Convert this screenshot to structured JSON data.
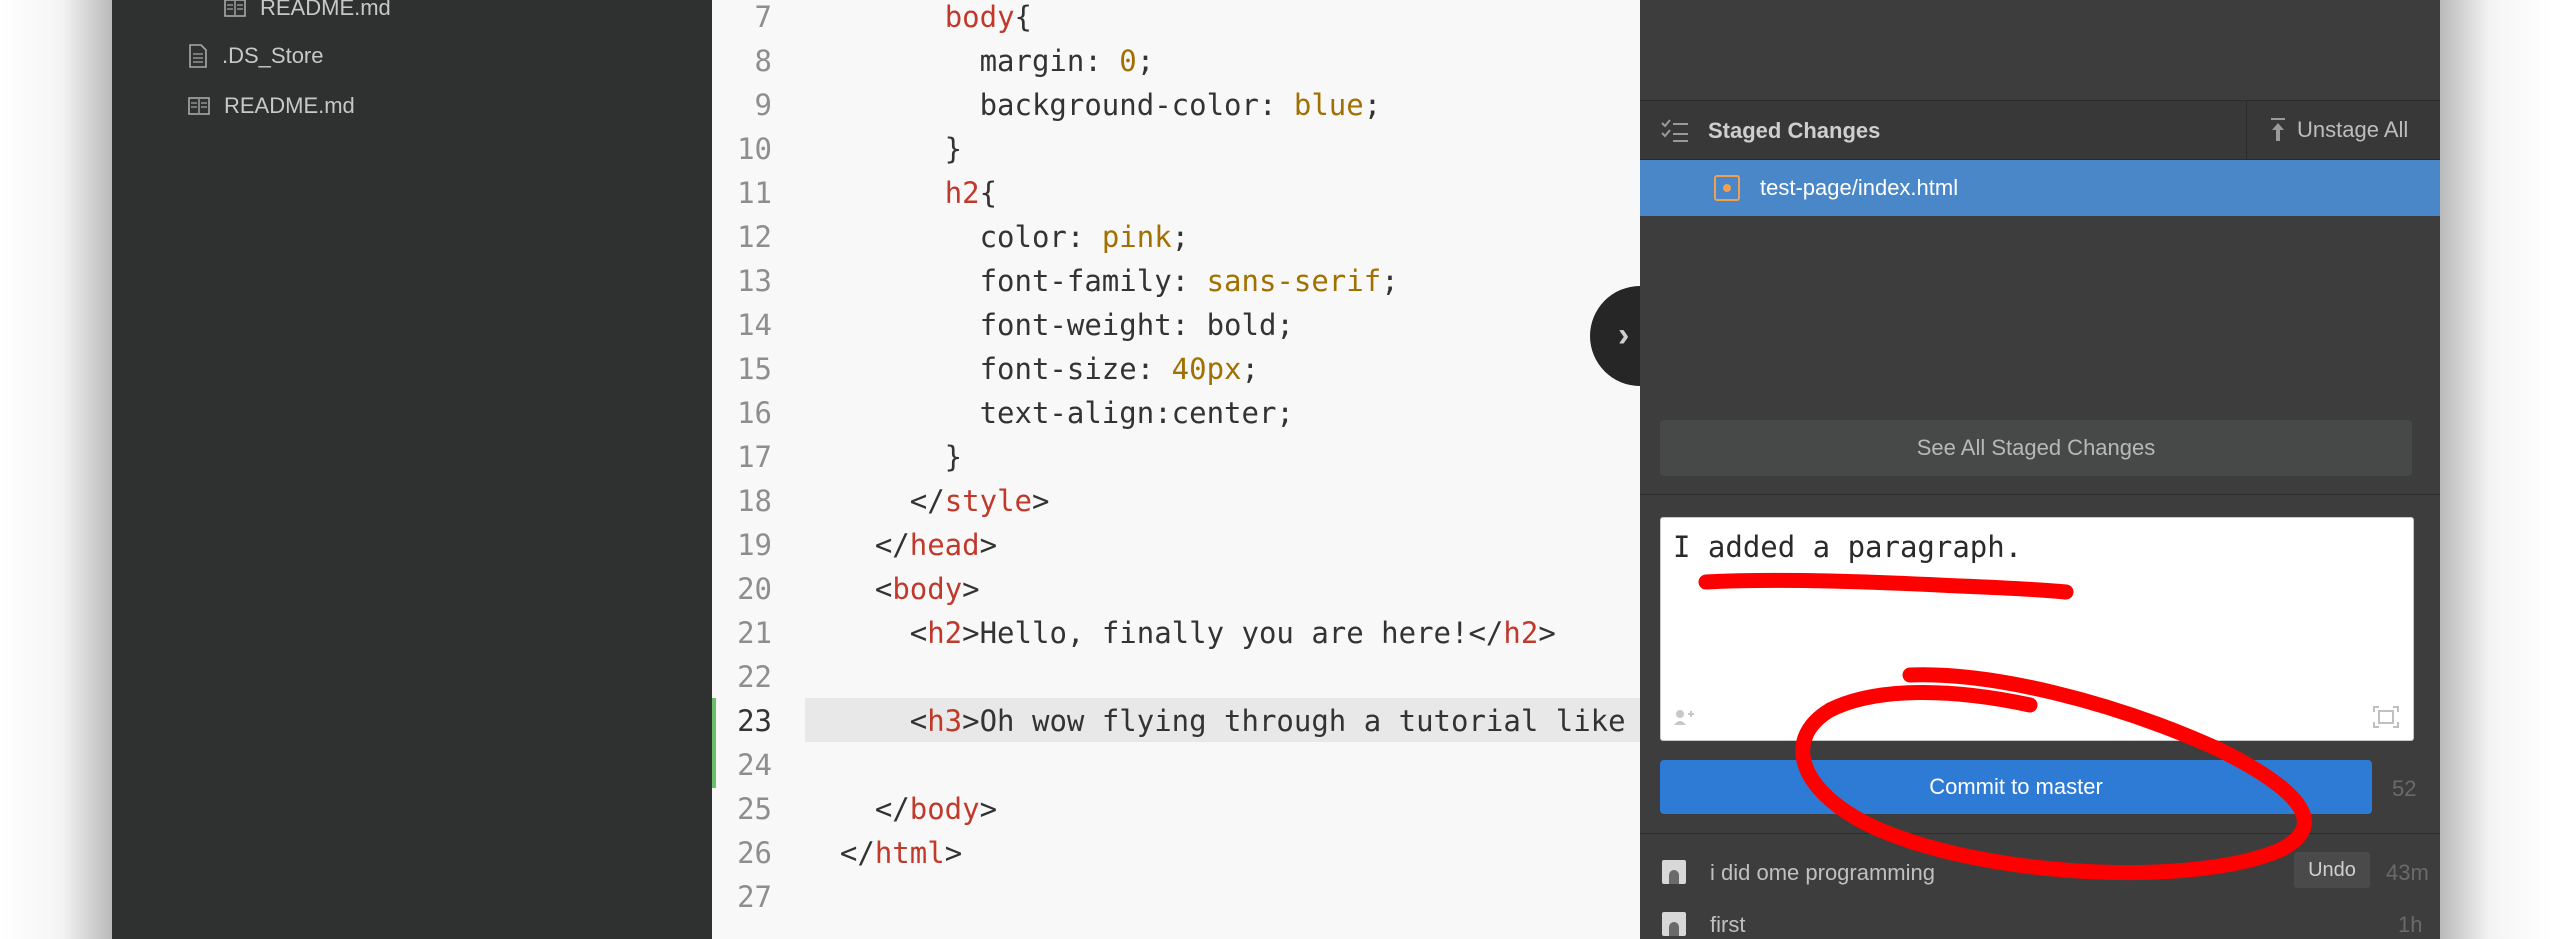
{
  "sidebar": {
    "files": [
      {
        "name": "README.md",
        "icon": "markdown-file-icon"
      },
      {
        "name": ".DS_Store",
        "icon": "text-file-icon"
      },
      {
        "name": "README.md",
        "icon": "markdown-file-icon"
      }
    ]
  },
  "editor": {
    "lines": [
      {
        "n": "7",
        "code": [
          [
            "        ",
            ""
          ],
          [
            "body",
            "tag"
          ],
          [
            "{",
            ""
          ]
        ]
      },
      {
        "n": "8",
        "code": [
          [
            "          margin: ",
            ""
          ],
          [
            "0",
            "val"
          ],
          [
            ";",
            ""
          ]
        ]
      },
      {
        "n": "9",
        "code": [
          [
            "          background-color: ",
            ""
          ],
          [
            "blue",
            "val"
          ],
          [
            ";",
            ""
          ]
        ]
      },
      {
        "n": "10",
        "code": [
          [
            "        }",
            ""
          ]
        ]
      },
      {
        "n": "11",
        "code": [
          [
            "        ",
            ""
          ],
          [
            "h2",
            "tag"
          ],
          [
            "{",
            ""
          ]
        ]
      },
      {
        "n": "12",
        "code": [
          [
            "          color: ",
            ""
          ],
          [
            "pink",
            "val"
          ],
          [
            ";",
            ""
          ]
        ]
      },
      {
        "n": "13",
        "code": [
          [
            "          font-family: ",
            ""
          ],
          [
            "sans-serif",
            "val"
          ],
          [
            ";",
            ""
          ]
        ]
      },
      {
        "n": "14",
        "code": [
          [
            "          font-weight: bold;",
            ""
          ]
        ]
      },
      {
        "n": "15",
        "code": [
          [
            "          font-size: ",
            ""
          ],
          [
            "40px",
            "val"
          ],
          [
            ";",
            ""
          ]
        ]
      },
      {
        "n": "16",
        "code": [
          [
            "          text-align:center;",
            ""
          ]
        ]
      },
      {
        "n": "17",
        "code": [
          [
            "        }",
            ""
          ]
        ]
      },
      {
        "n": "18",
        "code": [
          [
            "      </",
            ""
          ],
          [
            "style",
            "tag"
          ],
          [
            ">",
            ""
          ]
        ]
      },
      {
        "n": "19",
        "code": [
          [
            "    </",
            ""
          ],
          [
            "head",
            "tag"
          ],
          [
            ">",
            ""
          ]
        ]
      },
      {
        "n": "20",
        "code": [
          [
            "    <",
            ""
          ],
          [
            "body",
            "tag"
          ],
          [
            ">",
            ""
          ]
        ]
      },
      {
        "n": "21",
        "code": [
          [
            "      <",
            ""
          ],
          [
            "h2",
            "tag"
          ],
          [
            ">Hello, finally you are here!</",
            ""
          ],
          [
            "h2",
            "tag"
          ],
          [
            ">",
            ""
          ]
        ]
      },
      {
        "n": "22",
        "code": []
      },
      {
        "n": "23",
        "code": [
          [
            "      <",
            ""
          ],
          [
            "h3",
            "tag"
          ],
          [
            ">Oh wow flying through a tutorial like t",
            ""
          ]
        ]
      },
      {
        "n": "24",
        "code": []
      },
      {
        "n": "25",
        "code": [
          [
            "    </",
            ""
          ],
          [
            "body",
            "tag"
          ],
          [
            ">",
            ""
          ]
        ]
      },
      {
        "n": "26",
        "code": [
          [
            "  </",
            ""
          ],
          [
            "html",
            "tag"
          ],
          [
            ">",
            ""
          ]
        ]
      },
      {
        "n": "27",
        "code": []
      }
    ]
  },
  "git": {
    "staged_title": "Staged Changes",
    "unstage_all": "Unstage All",
    "staged_files": [
      "test-page/index.html"
    ],
    "see_all": "See All Staged Changes",
    "commit_message": "I added a paragraph.",
    "commit_button": "Commit to master",
    "char_count": "52",
    "history": [
      {
        "message": "i did ome programming",
        "time": "43m",
        "undo": "Undo"
      },
      {
        "message": "first",
        "time": "1h"
      }
    ]
  },
  "colors": {
    "sidebar_bg": "#2f3030",
    "editor_bg": "#f8f8f8",
    "panel_bg": "#3d3d3d",
    "selection_blue": "#4a87c8",
    "commit_blue": "#2e7bd6",
    "annotation_red": "#ff0000"
  }
}
